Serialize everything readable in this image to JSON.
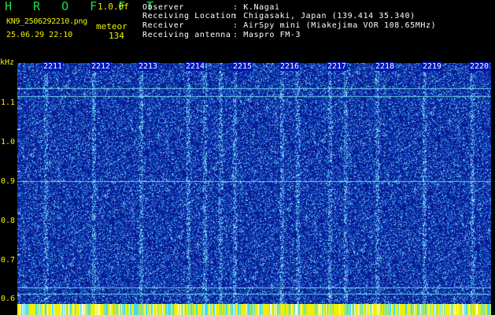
{
  "header": {
    "title": "H R O F F T",
    "version": "1.0.0f",
    "filename": "KN9_2506292210.png",
    "mode": "meteor",
    "datetime": "25.06.29 22:10",
    "count": "134"
  },
  "info": [
    {
      "label": "Observer",
      "value": ": K.Nagai"
    },
    {
      "label": "Receiving Location",
      "value": ": Chigasaki, Japan (139.414 35.340)"
    },
    {
      "label": "Receiver",
      "value": ": AirSpy mini (Miakejima VOR 108.65MHz)"
    },
    {
      "label": "Receiving antenna",
      "value": ": Maspro FM-3"
    }
  ],
  "axes": {
    "y_unit": "kHz",
    "y_ticks": [
      "1.1",
      "1.0",
      "0.9",
      "0.8",
      "0.7",
      "0.6"
    ],
    "x_ticks": [
      "2211",
      "2212",
      "2213",
      "2214",
      "2215",
      "2216",
      "2217",
      "2218",
      "2219",
      "2220"
    ]
  },
  "colors": {
    "background": "#000000",
    "title": "#19e04a",
    "labels": "#f0f000",
    "spectrogram_base": "#0a1aa0",
    "noise_dots": "#66ccff",
    "bottom_bar": "#f0f000"
  },
  "chart_data": {
    "type": "heatmap",
    "y_range_khz": [
      0.58,
      1.16
    ],
    "y_ticks": [
      1.1,
      1.0,
      0.9,
      0.8,
      0.7,
      0.6
    ],
    "x_ticks": [
      "2211",
      "2212",
      "2213",
      "2214",
      "2215",
      "2216",
      "2217",
      "2218",
      "2219",
      "2220"
    ],
    "horizontal_lines_khz": [
      1.1,
      1.08,
      0.875,
      0.62,
      0.605
    ],
    "xlabel": "",
    "ylabel": "kHz"
  }
}
